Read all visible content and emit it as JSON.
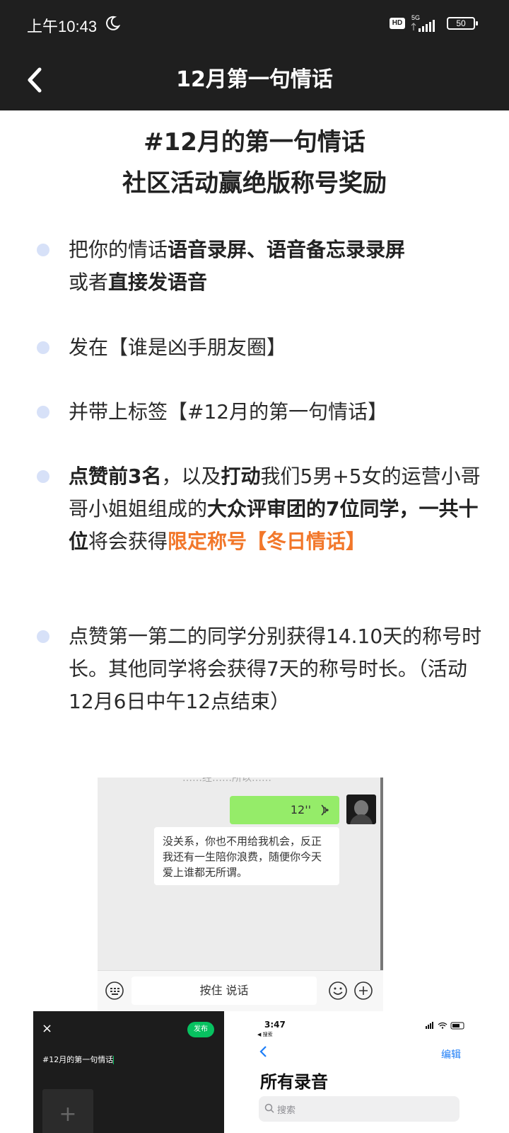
{
  "status_bar": {
    "time": "上午10:43",
    "hd_label": "HD",
    "network": "5G",
    "battery": "50"
  },
  "nav": {
    "title": "12月第一句情话"
  },
  "headline": {
    "line1": "#12月的第一句情话",
    "line2": "社区活动赢绝版称号奖励"
  },
  "bullets": [
    {
      "parts": [
        "把你的情话",
        "语音录屏、语音备忘录录屏",
        "或者",
        "直接发语音"
      ]
    },
    {
      "text": "发在【谁是凶手朋友圈】"
    },
    {
      "text": "并带上标签【#12月的第一句情话】"
    },
    {
      "parts": [
        "点赞前3名",
        "，以及",
        "打动",
        "我们5男+5女的运营小哥哥小姐姐组成的",
        "大众评审团的7位同学，一共十位",
        "将会获得",
        "限定称号【冬日情话】"
      ]
    },
    {
      "text": "点赞第一第二的同学分别获得14.10天的称号时长。其他同学将会获得7天的称号时长。（活动 12月6日中午12点结束）"
    }
  ],
  "chat_screenshot": {
    "top_clip": "……经……所以……",
    "voice_duration": "12''",
    "message": "没关系，你也不用给我机会，反正我还有一生陪你浪费，随便你今天爱上谁都无所谓。",
    "hold_to_talk": "按住 说话"
  },
  "post_screenshot": {
    "close": "×",
    "publish": "发布",
    "text": "#12月的第一句情话",
    "add": "+"
  },
  "recordings_screenshot": {
    "time": "3:47",
    "back_label": "◀ 搜索",
    "edit": "编辑",
    "title": "所有录音",
    "search_placeholder": "搜索"
  }
}
